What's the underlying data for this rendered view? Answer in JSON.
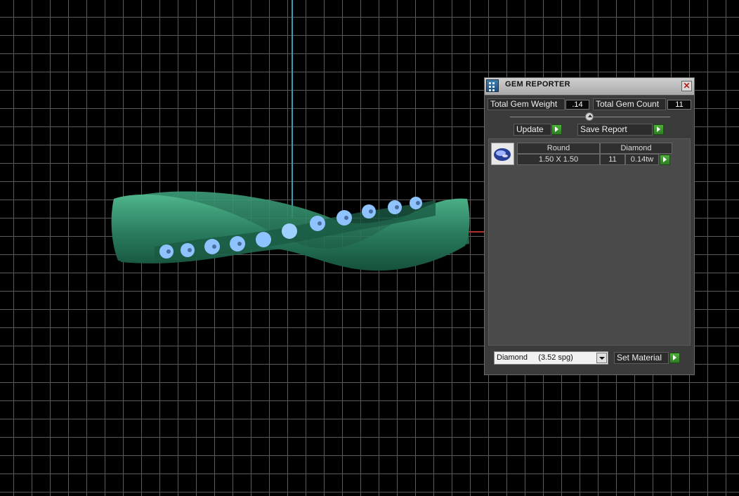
{
  "panel": {
    "title": "GEM REPORTER",
    "total_weight_label": "Total Gem Weight",
    "total_weight_value": ".14",
    "total_count_label": "Total Gem Count",
    "total_count_value": "11",
    "update_label": "Update",
    "save_report_label": "Save Report",
    "table": {
      "headers": [
        "Round",
        "Diamond"
      ],
      "row": {
        "size": "1.50 X 1.50",
        "count": "11",
        "weight": "0.14tw"
      }
    },
    "material_select": "Diamond     (3.52 spg)",
    "set_material_label": "Set Material"
  },
  "colors": {
    "ring": "#2e8a6a",
    "gem": "#8fc3ff",
    "go_button": "#3f9a30",
    "axis_vertical": "#3a9bb4",
    "axis_horizontal": "#b03030"
  },
  "icons": [
    "app-icon",
    "close-icon",
    "gem-thumbnail-icon",
    "play-arrow-icon",
    "dropdown-arrow-icon"
  ]
}
